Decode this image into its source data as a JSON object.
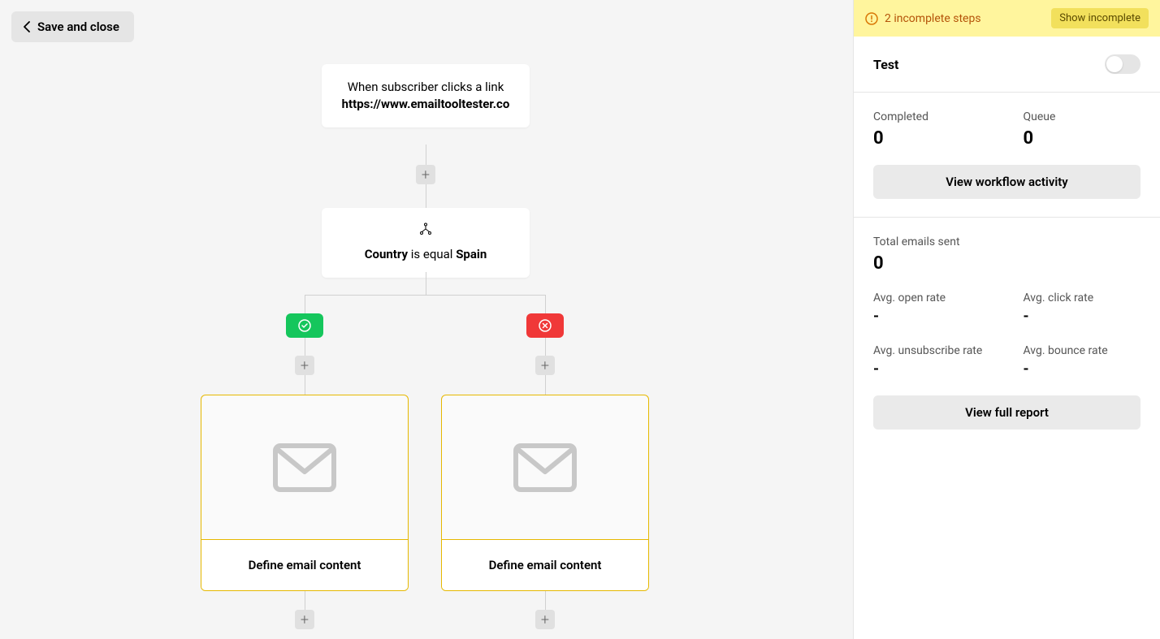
{
  "toolbar": {
    "save_close": "Save and close"
  },
  "workflow": {
    "trigger": {
      "line1": "When subscriber clicks a link",
      "link": "https://www.emailtooltester.co"
    },
    "condition": {
      "field": "Country",
      "operator": "is equal",
      "value": "Spain"
    },
    "branches": {
      "yes_email": "Define email content",
      "no_email": "Define email content"
    }
  },
  "sidebar": {
    "alert": {
      "message": "2 incomplete steps",
      "button": "Show incomplete"
    },
    "test": {
      "label": "Test",
      "enabled": false
    },
    "activity": {
      "completed_label": "Completed",
      "completed_value": "0",
      "queue_label": "Queue",
      "queue_value": "0",
      "button": "View workflow activity"
    },
    "report": {
      "total_label": "Total emails sent",
      "total_value": "0",
      "open_label": "Avg. open rate",
      "open_value": "-",
      "click_label": "Avg. click rate",
      "click_value": "-",
      "unsub_label": "Avg. unsubscribe rate",
      "unsub_value": "-",
      "bounce_label": "Avg. bounce rate",
      "bounce_value": "-",
      "button": "View full report"
    }
  }
}
